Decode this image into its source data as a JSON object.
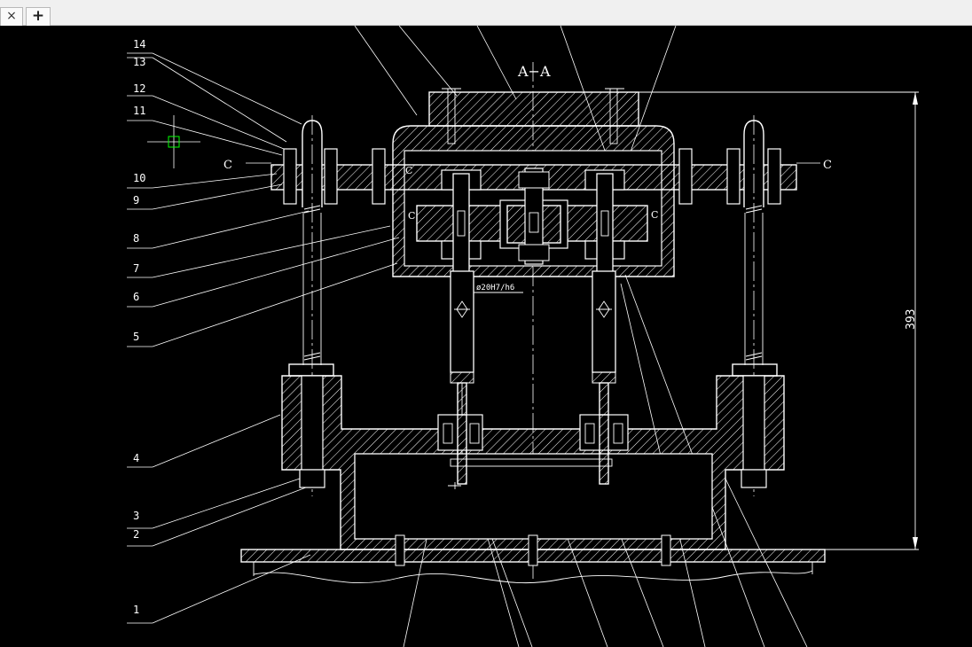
{
  "tabs": {
    "close_glyph": "×",
    "new_glyph": "+"
  },
  "drawing": {
    "section_title": "A−A",
    "cut_label_left": "C",
    "cut_label_right": "C",
    "inner_c_marks": [
      "C",
      "C",
      "C"
    ],
    "fit_annotation": "ø20H7/h6",
    "dimension_393": "393",
    "part_labels": [
      "14",
      "13",
      "12",
      "11",
      "10",
      "9",
      "8",
      "7",
      "6",
      "5",
      "4",
      "3",
      "2",
      "1"
    ]
  },
  "colors": {
    "background": "#000000",
    "linework": "#ffffff",
    "cursor": "#00ff00"
  }
}
